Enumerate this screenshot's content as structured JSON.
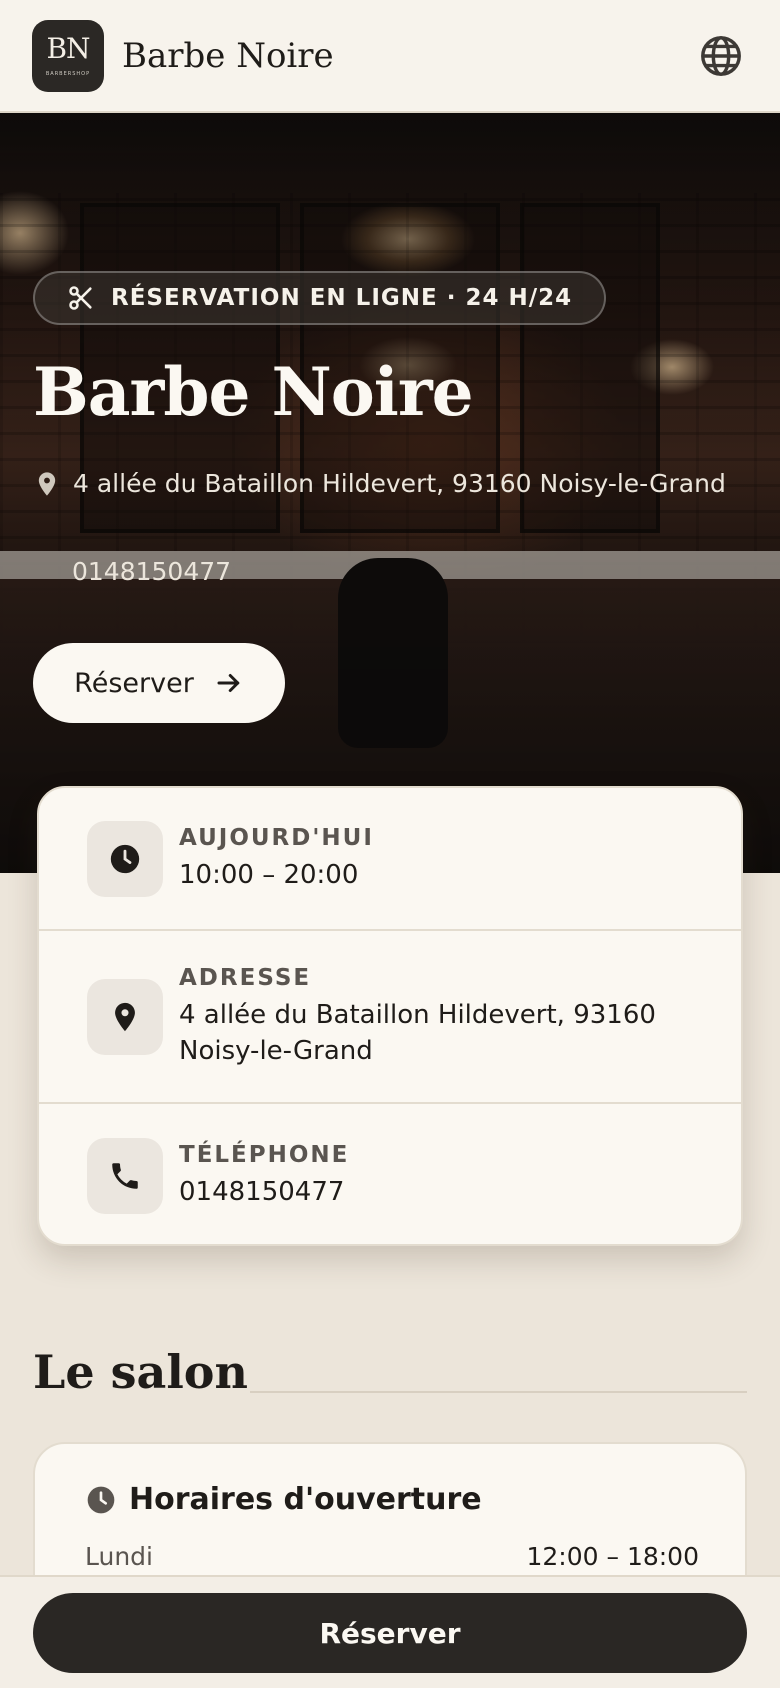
{
  "header": {
    "logo_monogram": "BN",
    "logo_subtitle": "BARBERSHOP",
    "brand_name": "Barbe Noire",
    "language_icon": "globe-icon"
  },
  "hero": {
    "badge_icon": "scissors-icon",
    "badge_text": "RÉSERVATION EN LIGNE · 24 H/24",
    "title": "Barbe Noire",
    "address_icon": "map-pin-icon",
    "address": "4 allée du Bataillon Hildevert, 93160 Noisy-le-Grand",
    "phone": "0148150477",
    "cta_label": "Réserver",
    "cta_icon": "arrow-right-icon"
  },
  "info": {
    "today": {
      "icon": "clock-icon",
      "label": "AUJOURD'HUI",
      "value": "10:00 – 20:00"
    },
    "address": {
      "icon": "map-pin-icon",
      "label": "ADRESSE",
      "value": "4 allée du Bataillon Hildevert, 93160 Noisy-le-Grand"
    },
    "phone": {
      "icon": "phone-icon",
      "label": "TÉLÉPHONE",
      "value": "0148150477"
    }
  },
  "salon": {
    "title": "Le salon",
    "hours": {
      "icon": "clock-icon",
      "title": "Horaires d'ouverture",
      "rows": [
        {
          "day": "Lundi",
          "time": "12:00 – 18:00"
        }
      ]
    }
  },
  "bottom": {
    "cta_label": "Réserver"
  },
  "colors": {
    "dark": "#2a2724",
    "cream": "#fbf8f2",
    "background": "#ece5da"
  }
}
